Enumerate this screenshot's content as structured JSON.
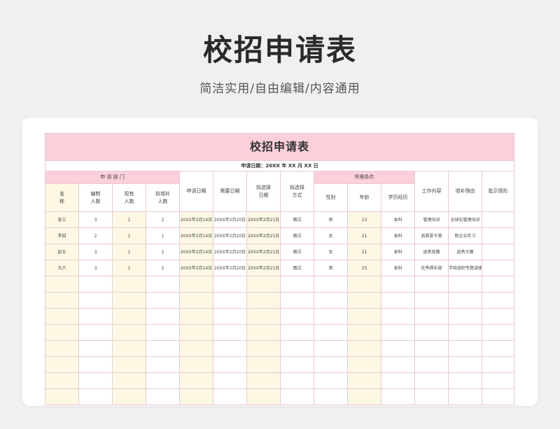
{
  "hero": {
    "title": "校招申请表",
    "subtitle": "简洁实用/自由编辑/内容通用"
  },
  "sheet": {
    "title": "校招申请表",
    "date_line": "申请日期：20XX   年 XX   月    XX  日",
    "groups": {
      "dept": "申 请 部 门",
      "requirements": "所需条件"
    },
    "headers": {
      "name": "名\n称",
      "quota": "编制\n人数",
      "current": "现有\n人数",
      "to_fill": "拟增补\n人数",
      "apply_date": "申请日期",
      "need_date": "需要日期",
      "select_date": "拟选择\n日期",
      "select_method": "拟选择\n方式",
      "gender": "性别",
      "age": "年龄",
      "education": "学历经历",
      "work": "工作内容",
      "reason": "增补理由",
      "approval": "批示情形"
    },
    "rows": [
      [
        "张三",
        "3",
        "1",
        "2",
        "20XX年2月14日",
        "20XX年2月20日",
        "20XX年2月21日",
        "面试",
        "男",
        "23",
        "本科",
        "管理培训",
        "全球化管理培训"
      ],
      [
        "李四",
        "2",
        "1",
        "1",
        "20XX年2月14日",
        "20XX年2月20日",
        "20XX年2月21日",
        "面试",
        "女",
        "21",
        "本科",
        "品质夏令营",
        "制企业实习"
      ],
      [
        "赵五",
        "3",
        "1",
        "2",
        "20XX年2月14日",
        "20XX年2月20日",
        "20XX年2月21日",
        "面试",
        "女",
        "21",
        "本科",
        "选秀竞赛",
        "选秀大赛"
      ],
      [
        "王六",
        "3",
        "1",
        "2",
        "20XX年2月14日",
        "20XX年2月20日",
        "20XX年2月21日",
        "面试",
        "男",
        "25",
        "本科",
        "优秀俱乐部",
        "学校组织专题讲座"
      ]
    ],
    "empty_row_count": 8
  },
  "colors": {
    "header_pink": "#fbd0db",
    "cream": "#fdf8e3",
    "border": "#e8c9d3"
  }
}
